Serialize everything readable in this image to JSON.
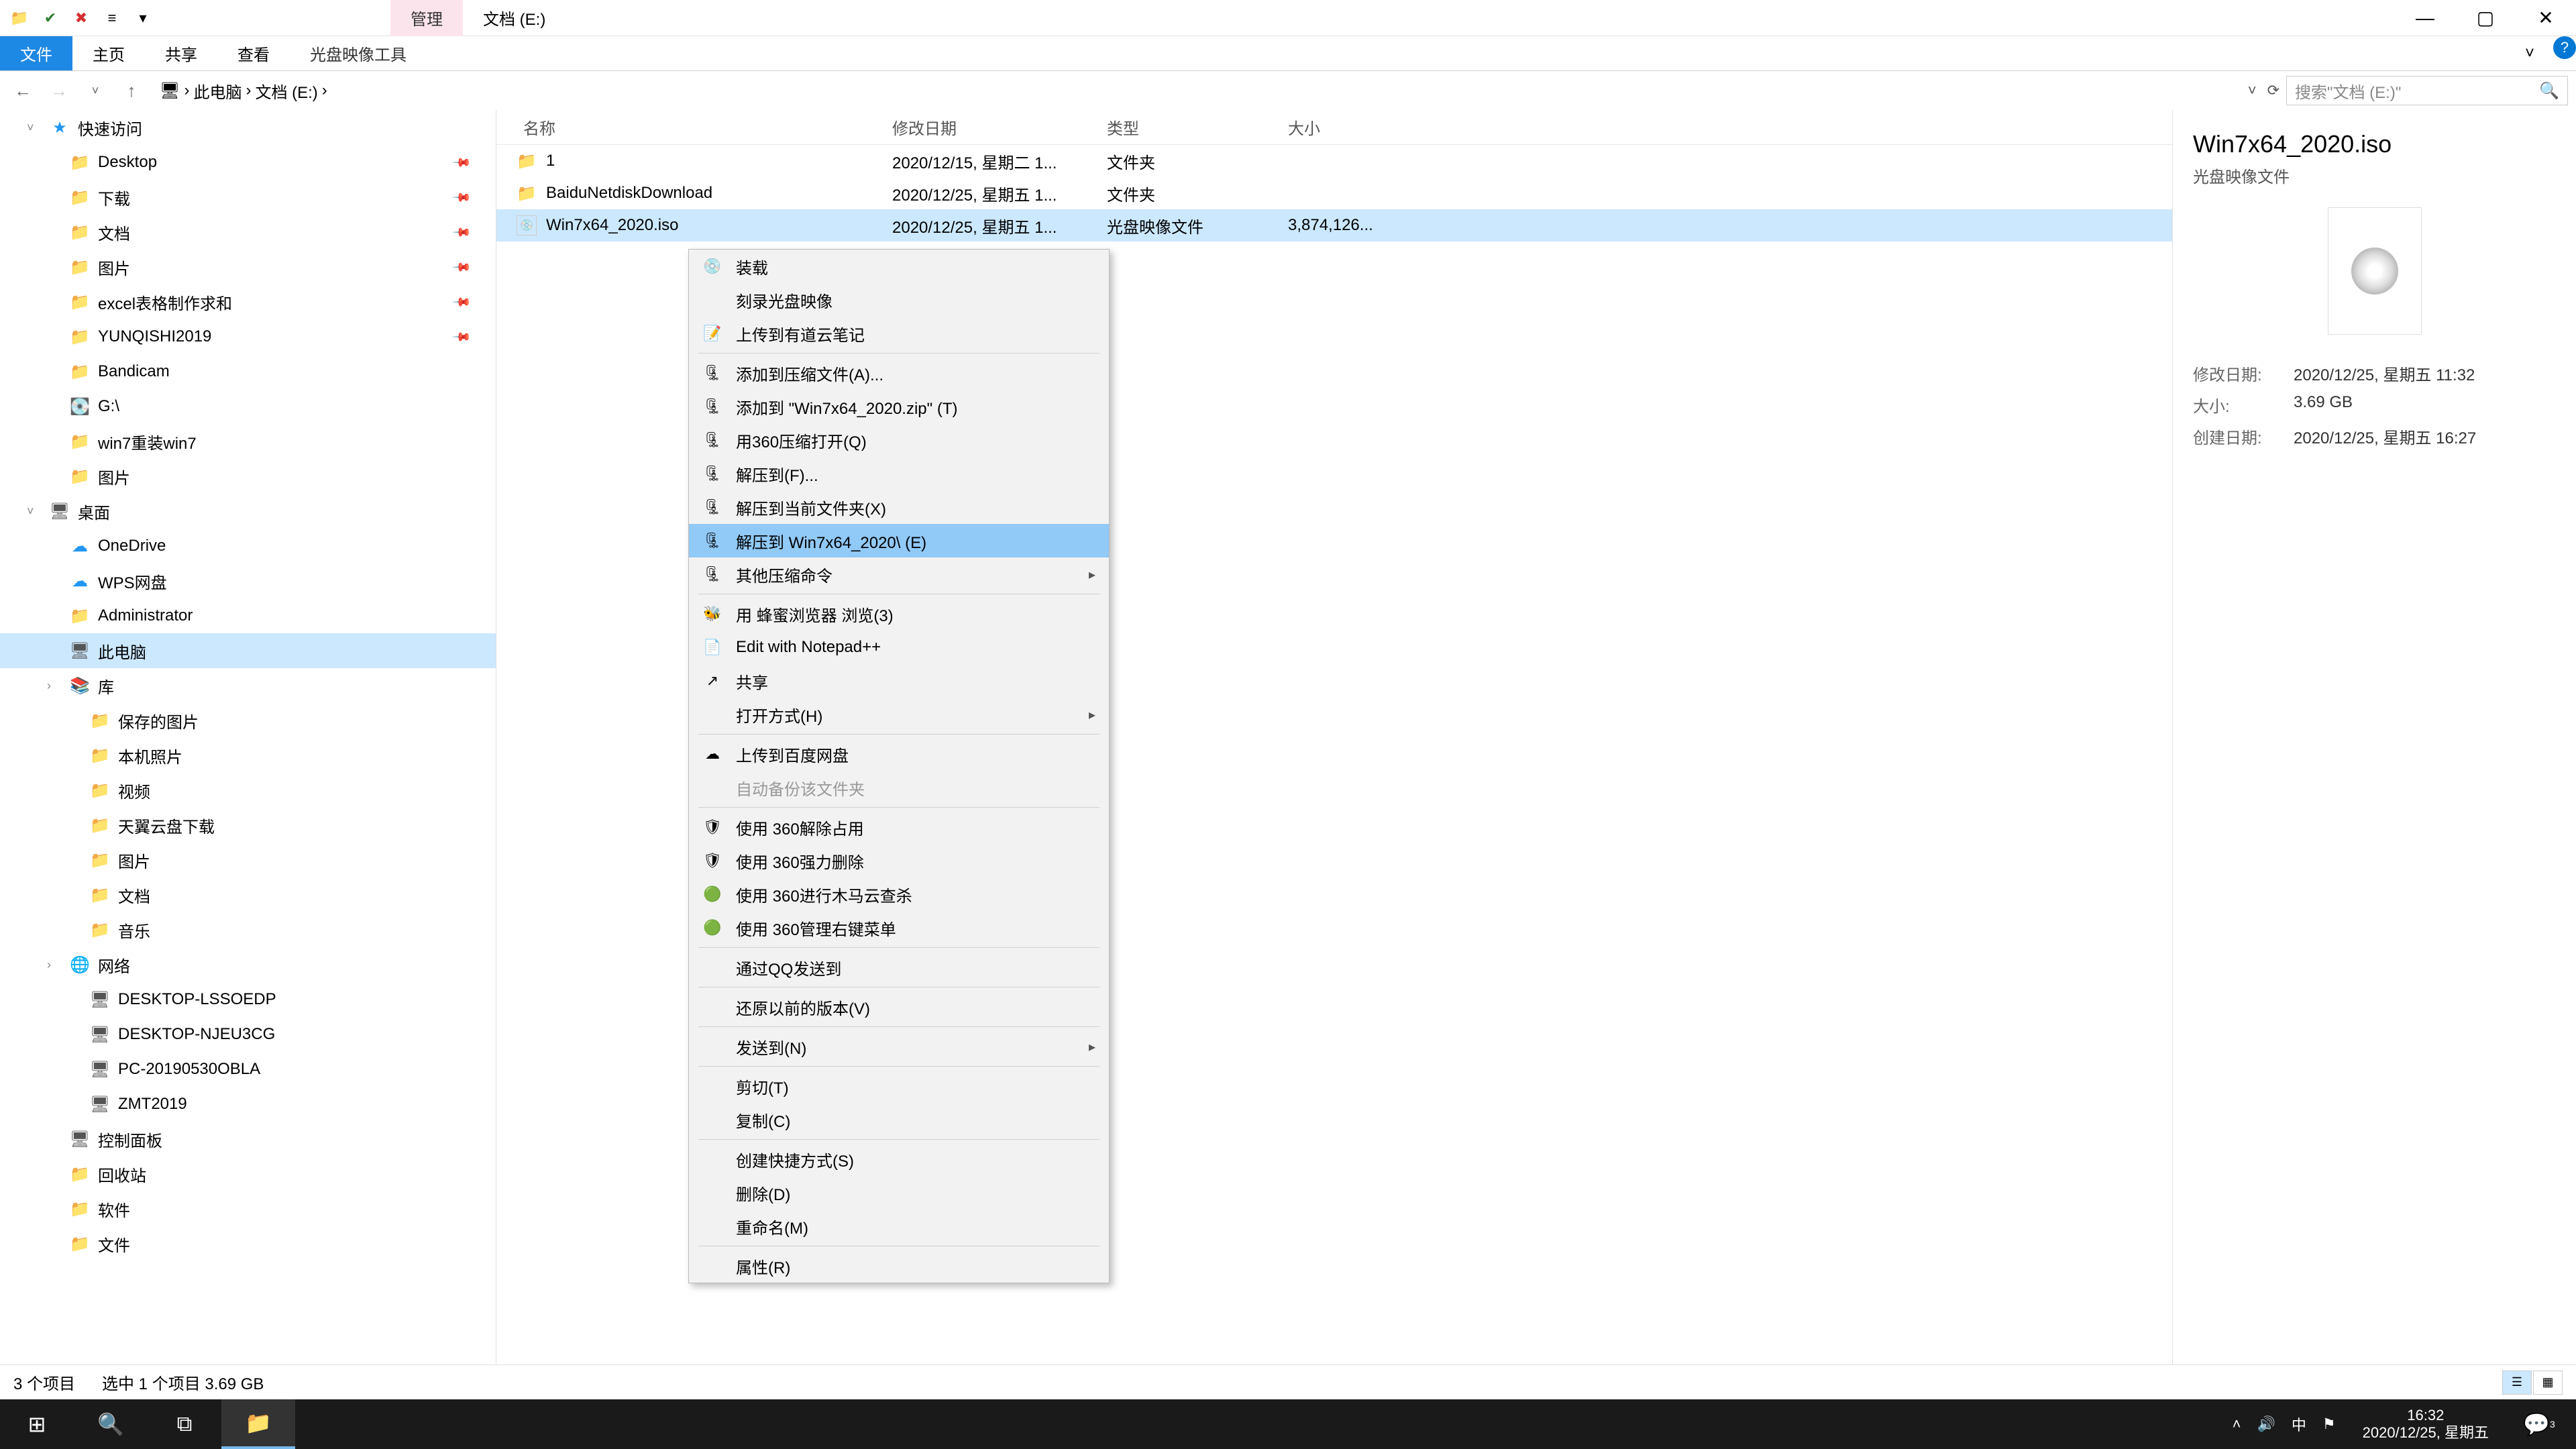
{
  "titlebar": {
    "qat_icons": [
      "folder-icon",
      "check-icon",
      "x-icon",
      "eq-icon",
      "dropdown-icon"
    ],
    "tab_manage": "管理",
    "tab_path": "文档 (E:)"
  },
  "ribbon": {
    "file": "文件",
    "home": "主页",
    "share": "共享",
    "view": "查看",
    "disc_tools": "光盘映像工具"
  },
  "address": {
    "crumbs": [
      "此电脑",
      "文档 (E:)"
    ],
    "search_placeholder": "搜索\"文档 (E:)\""
  },
  "sidebar": [
    {
      "lvl": 0,
      "ic": "star",
      "label": "快速访问",
      "caret": "v"
    },
    {
      "lvl": 1,
      "ic": "folder",
      "label": "Desktop",
      "pin": true
    },
    {
      "lvl": 1,
      "ic": "folder",
      "label": "下载",
      "pin": true
    },
    {
      "lvl": 1,
      "ic": "folder",
      "label": "文档",
      "pin": true
    },
    {
      "lvl": 1,
      "ic": "folder",
      "label": "图片",
      "pin": true
    },
    {
      "lvl": 1,
      "ic": "folder",
      "label": "excel表格制作求和",
      "pin": true
    },
    {
      "lvl": 1,
      "ic": "folder",
      "label": "YUNQISHI2019",
      "pin": true
    },
    {
      "lvl": 1,
      "ic": "folder",
      "label": "Bandicam"
    },
    {
      "lvl": 1,
      "ic": "disk",
      "label": "G:\\"
    },
    {
      "lvl": 1,
      "ic": "folder",
      "label": "win7重装win7"
    },
    {
      "lvl": 1,
      "ic": "folder",
      "label": "图片"
    },
    {
      "lvl": 0,
      "ic": "monitor",
      "label": "桌面",
      "caret": "v"
    },
    {
      "lvl": 1,
      "ic": "cloud",
      "label": "OneDrive"
    },
    {
      "lvl": 1,
      "ic": "cloud",
      "label": "WPS网盘"
    },
    {
      "lvl": 1,
      "ic": "folder",
      "label": "Administrator"
    },
    {
      "lvl": 1,
      "ic": "monitor",
      "label": "此电脑",
      "selected": true
    },
    {
      "lvl": 1,
      "ic": "lib",
      "label": "库",
      "caret": ">"
    },
    {
      "lvl": 2,
      "ic": "folder",
      "label": "保存的图片"
    },
    {
      "lvl": 2,
      "ic": "folder",
      "label": "本机照片"
    },
    {
      "lvl": 2,
      "ic": "folder",
      "label": "视频"
    },
    {
      "lvl": 2,
      "ic": "folder",
      "label": "天翼云盘下载"
    },
    {
      "lvl": 2,
      "ic": "folder",
      "label": "图片"
    },
    {
      "lvl": 2,
      "ic": "folder",
      "label": "文档"
    },
    {
      "lvl": 2,
      "ic": "folder",
      "label": "音乐"
    },
    {
      "lvl": 1,
      "ic": "net",
      "label": "网络",
      "caret": ">"
    },
    {
      "lvl": 2,
      "ic": "monitor",
      "label": "DESKTOP-LSSOEDP"
    },
    {
      "lvl": 2,
      "ic": "monitor",
      "label": "DESKTOP-NJEU3CG"
    },
    {
      "lvl": 2,
      "ic": "monitor",
      "label": "PC-20190530OBLA"
    },
    {
      "lvl": 2,
      "ic": "monitor",
      "label": "ZMT2019"
    },
    {
      "lvl": 1,
      "ic": "monitor",
      "label": "控制面板"
    },
    {
      "lvl": 1,
      "ic": "folder",
      "label": "回收站"
    },
    {
      "lvl": 1,
      "ic": "folder",
      "label": "软件"
    },
    {
      "lvl": 1,
      "ic": "folder",
      "label": "文件"
    }
  ],
  "columns": {
    "name": "名称",
    "date": "修改日期",
    "type": "类型",
    "size": "大小"
  },
  "rows": [
    {
      "ic": "folder",
      "name": "1",
      "date": "2020/12/15, 星期二 1...",
      "type": "文件夹",
      "size": ""
    },
    {
      "ic": "folder",
      "name": "BaiduNetdiskDownload",
      "date": "2020/12/25, 星期五 1...",
      "type": "文件夹",
      "size": ""
    },
    {
      "ic": "iso",
      "name": "Win7x64_2020.iso",
      "date": "2020/12/25, 星期五 1...",
      "type": "光盘映像文件",
      "size": "3,874,126...",
      "selected": true
    }
  ],
  "context_menu": [
    {
      "ic": "disc",
      "label": "装载"
    },
    {
      "label": "刻录光盘映像"
    },
    {
      "ic": "note",
      "label": "上传到有道云笔记"
    },
    {
      "sep": true
    },
    {
      "ic": "zip",
      "label": "添加到压缩文件(A)..."
    },
    {
      "ic": "zip",
      "label": "添加到 \"Win7x64_2020.zip\" (T)"
    },
    {
      "ic": "zip",
      "label": "用360压缩打开(Q)"
    },
    {
      "ic": "zip",
      "label": "解压到(F)..."
    },
    {
      "ic": "zip",
      "label": "解压到当前文件夹(X)"
    },
    {
      "ic": "zip",
      "label": "解压到 Win7x64_2020\\ (E)",
      "highlight": true
    },
    {
      "ic": "zip",
      "label": "其他压缩命令",
      "arrow": true
    },
    {
      "sep": true
    },
    {
      "ic": "bee",
      "label": "用 蜂蜜浏览器 浏览(3)"
    },
    {
      "ic": "npp",
      "label": "Edit with Notepad++"
    },
    {
      "ic": "share",
      "label": "共享"
    },
    {
      "label": "打开方式(H)",
      "arrow": true
    },
    {
      "sep": true
    },
    {
      "ic": "baidu",
      "label": "上传到百度网盘"
    },
    {
      "label": "自动备份该文件夹",
      "disabled": true
    },
    {
      "sep": true
    },
    {
      "ic": "s360",
      "label": "使用 360解除占用"
    },
    {
      "ic": "s360",
      "label": "使用 360强力删除"
    },
    {
      "ic": "s360g",
      "label": "使用 360进行木马云查杀"
    },
    {
      "ic": "s360g",
      "label": "使用 360管理右键菜单"
    },
    {
      "sep": true
    },
    {
      "label": "通过QQ发送到"
    },
    {
      "sep": true
    },
    {
      "label": "还原以前的版本(V)"
    },
    {
      "sep": true
    },
    {
      "label": "发送到(N)",
      "arrow": true
    },
    {
      "sep": true
    },
    {
      "label": "剪切(T)"
    },
    {
      "label": "复制(C)"
    },
    {
      "sep": true
    },
    {
      "label": "创建快捷方式(S)"
    },
    {
      "label": "删除(D)"
    },
    {
      "label": "重命名(M)"
    },
    {
      "sep": true
    },
    {
      "label": "属性(R)"
    }
  ],
  "details": {
    "title": "Win7x64_2020.iso",
    "subtitle": "光盘映像文件",
    "modified_label": "修改日期:",
    "modified": "2020/12/25, 星期五 11:32",
    "size_label": "大小:",
    "size": "3.69 GB",
    "created_label": "创建日期:",
    "created": "2020/12/25, 星期五 16:27"
  },
  "statusbar": {
    "count": "3 个项目",
    "selection": "选中 1 个项目  3.69 GB"
  },
  "taskbar": {
    "ime": "中",
    "time": "16:32",
    "date": "2020/12/25, 星期五",
    "badge": "3"
  }
}
